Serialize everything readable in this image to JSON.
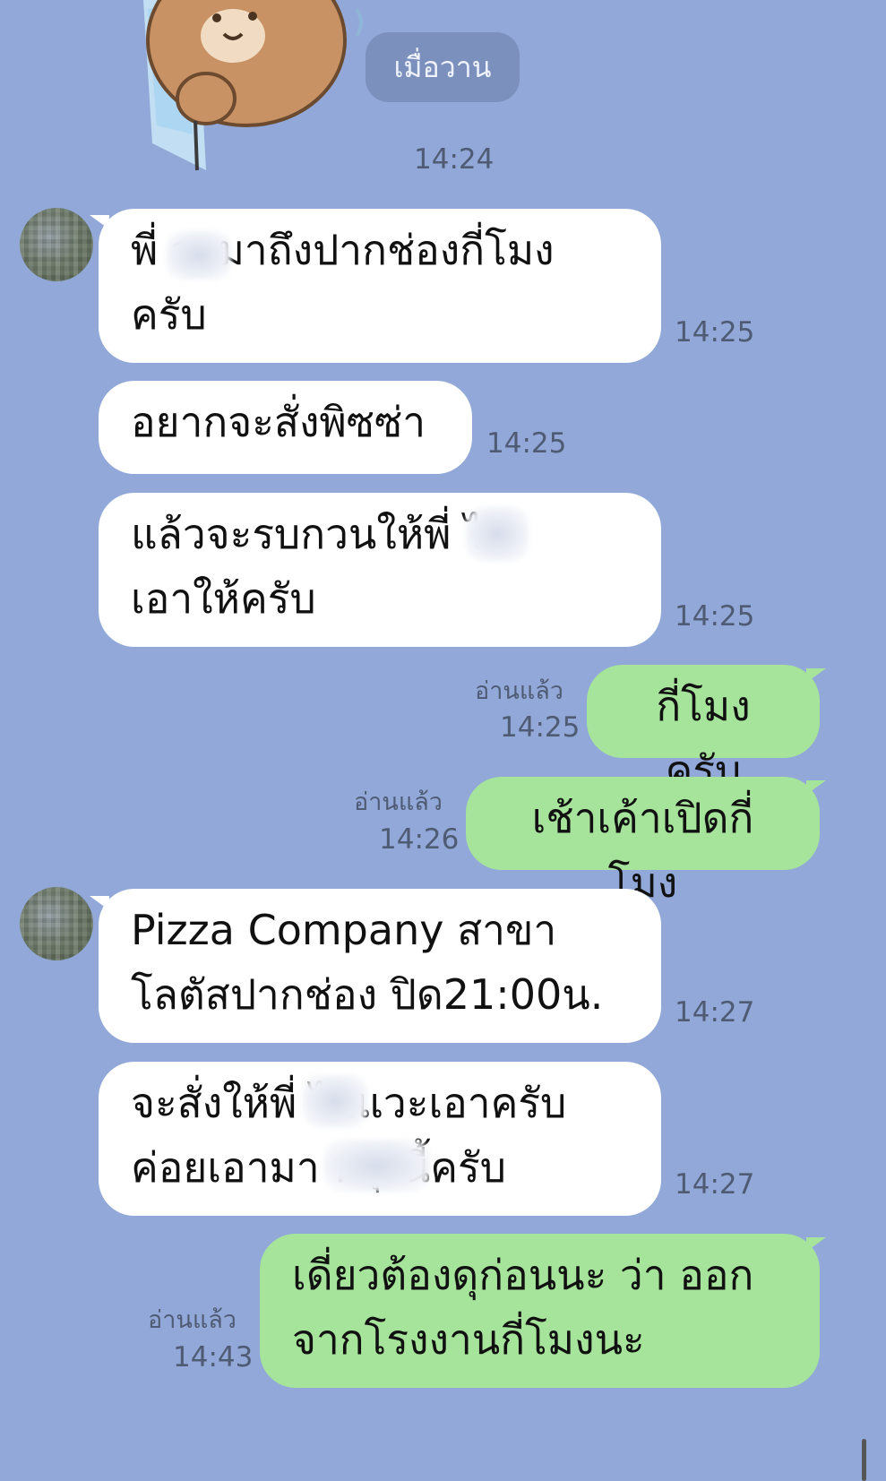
{
  "date_separator": "เมื่อวาน",
  "sticker": {
    "name": "brown-bear-sticker",
    "time": "14:24"
  },
  "messages": [
    {
      "dir": "in",
      "text": "พี่ จะมาถึงปากช่องกี่โมง\nครับ",
      "time": "14:25"
    },
    {
      "dir": "in",
      "text": "อยากจะสั่งพิซซ่า",
      "time": "14:25"
    },
    {
      "dir": "in",
      "text": "แล้วจะรบกวนให้พี่ ไป\nเอาให้ครับ",
      "time": "14:25"
    },
    {
      "dir": "out",
      "text": "กี่โมงครับ",
      "read": "อ่านแล้ว",
      "time": "14:25"
    },
    {
      "dir": "out",
      "text": "เช้าเค้าเปิดกี่โมง",
      "read": "อ่านแล้ว",
      "time": "14:26"
    },
    {
      "dir": "in",
      "text": "Pizza Company สาขา\nโลตัสปากช่อง ปิด21:00น.",
      "time": "14:27"
    },
    {
      "dir": "in",
      "text": "จะสั่งให้พี่ ไปแวะเอาครับ\nค่อยเอามา พรุ่งนี้ครับ",
      "time": "14:27"
    },
    {
      "dir": "out",
      "text": "เดี่ยวต้องดุก่อนนะ ว่า ออก\nจากโรงงานกี่โมงนะ",
      "read": "อ่านแล้ว",
      "time": "14:43"
    }
  ],
  "colors": {
    "background": "#91a8d8",
    "incoming_bubble": "#ffffff",
    "outgoing_bubble": "#a6e39b",
    "date_pill": "#7b90bc",
    "meta_text": "#4f5b73"
  }
}
